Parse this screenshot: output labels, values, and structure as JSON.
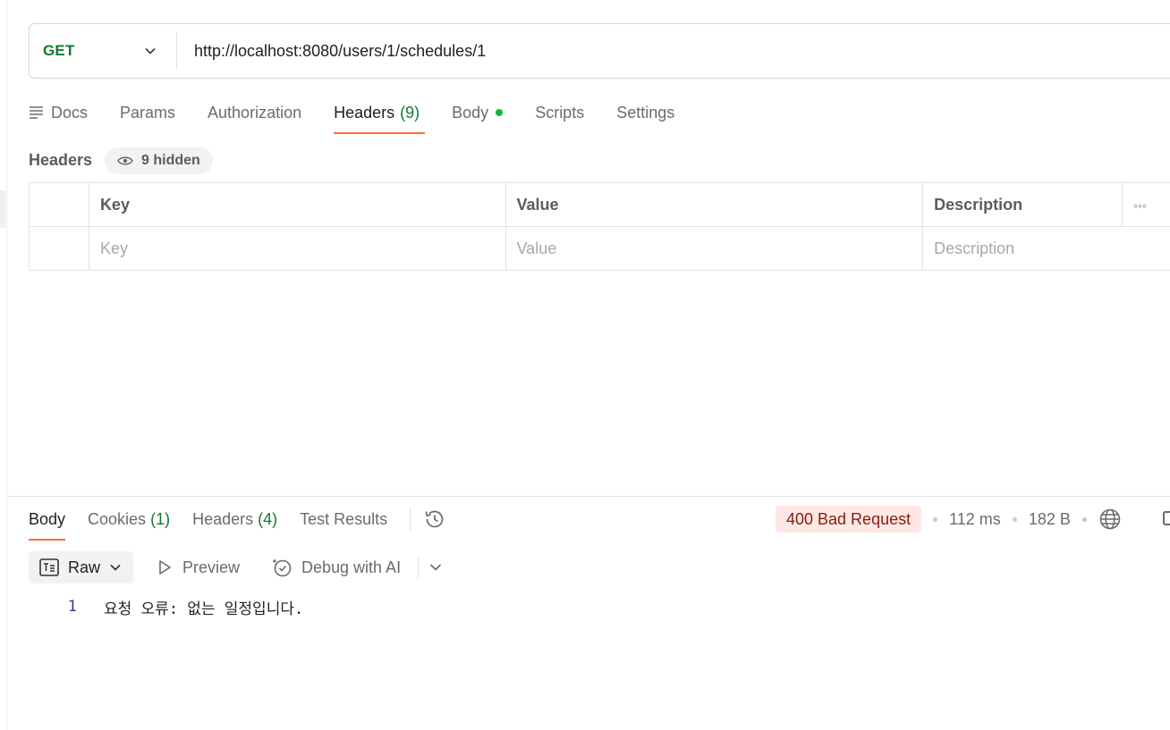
{
  "request": {
    "method": "GET",
    "url": "http://localhost:8080/users/1/schedules/1"
  },
  "request_tabs": [
    {
      "label": "Docs"
    },
    {
      "label": "Params"
    },
    {
      "label": "Authorization"
    },
    {
      "label": "Headers",
      "count": "(9)",
      "active": true
    },
    {
      "label": "Body",
      "has_dot": true
    },
    {
      "label": "Scripts"
    },
    {
      "label": "Settings"
    }
  ],
  "headers_section": {
    "title": "Headers",
    "hidden_pill": "9 hidden",
    "columns": [
      "Key",
      "Value",
      "Description"
    ],
    "placeholders": {
      "key": "Key",
      "value": "Value",
      "description": "Description"
    },
    "more_label": "◦◦◦"
  },
  "response_tabs": [
    {
      "label": "Body",
      "active": true
    },
    {
      "label": "Cookies",
      "count": "(1)"
    },
    {
      "label": "Headers",
      "count": "(4)"
    },
    {
      "label": "Test Results"
    }
  ],
  "response_status": {
    "status": "400 Bad Request",
    "time": "112 ms",
    "size": "182 B",
    "status_bg": "#fde8e4",
    "status_color": "#8b1a10"
  },
  "response_toolbar": {
    "format": "Raw",
    "preview": "Preview",
    "debug": "Debug with AI"
  },
  "response_body": {
    "lines": [
      {
        "number": "1",
        "text": "요청 오류: 없는 일정입니다."
      }
    ]
  },
  "colors": {
    "accent": "#ff6c37",
    "method_green": "#0f7b2f",
    "body_dot": "#10b83c"
  }
}
